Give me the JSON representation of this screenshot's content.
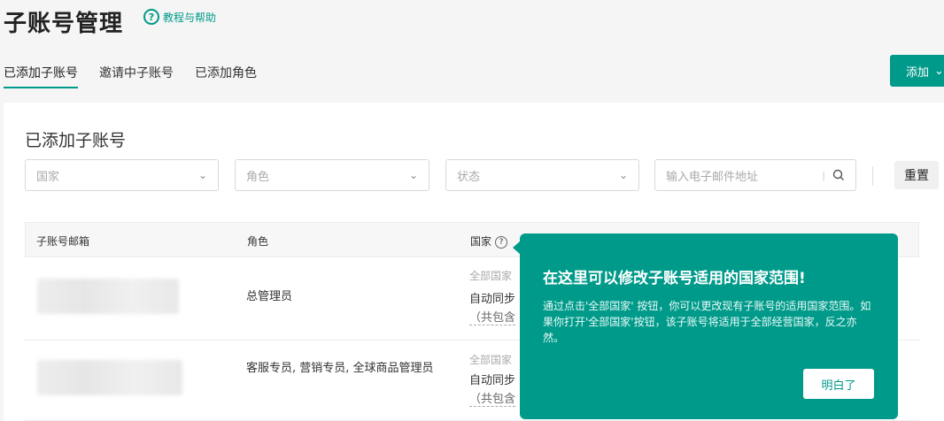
{
  "page": {
    "title": "子账号管理",
    "help_label": "教程与帮助",
    "help_icon": "lightbulb-question-icon"
  },
  "tabs": [
    {
      "label": "已添加子账号",
      "active": true
    },
    {
      "label": "邀请中子账号",
      "active": false
    },
    {
      "label": "已添加角色",
      "active": false
    }
  ],
  "add_button": {
    "label": "添加",
    "icon": "chevron-down-icon"
  },
  "colors": {
    "accent": "#009a8a"
  },
  "section": {
    "title": "已添加子账号"
  },
  "filters": {
    "country_placeholder": "国家",
    "role_placeholder": "角色",
    "status_placeholder": "状态",
    "email_placeholder": "输入电子邮件地址",
    "reset_label": "重置"
  },
  "table": {
    "columns": [
      "子账号邮箱",
      "角色",
      "国家"
    ],
    "rows": [
      {
        "role": "总管理员",
        "country_line1": "全部国家",
        "country_line2": "自动同步",
        "country_line3": "（共包含"
      },
      {
        "role": "客服专员, 营销专员, 全球商品管理员",
        "country_line1": "全部国家",
        "country_line2": "自动同步",
        "country_line3": "（共包含"
      }
    ]
  },
  "tooltip": {
    "title": "在这里可以修改子账号适用的国家范围!",
    "body": "通过点击'全部国家' 按钮，你可以更改现有子账号的适用国家范围。如果你打开'全部国家'按钮，该子账号将适用于全部经营国家，反之亦然。",
    "button_label": "明白了"
  }
}
